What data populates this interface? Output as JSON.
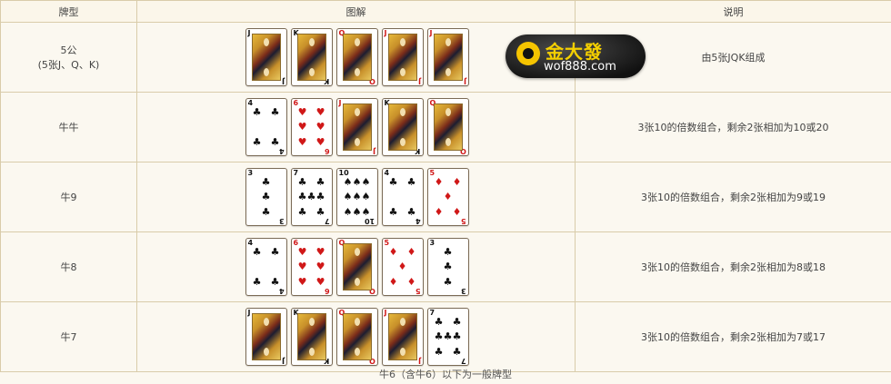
{
  "table": {
    "headers": [
      "牌型",
      "图解",
      "说明"
    ],
    "rows": [
      {
        "type": "5公",
        "type_sub": "(5张J、Q、K)",
        "note": "由5张JQK组成",
        "cards": [
          {
            "rank": "J",
            "suit": "♣",
            "color": "black",
            "face": true
          },
          {
            "rank": "K",
            "suit": "♣",
            "color": "black",
            "face": true
          },
          {
            "rank": "Q",
            "suit": "♥",
            "color": "red",
            "face": true
          },
          {
            "rank": "J",
            "suit": "♥",
            "color": "red",
            "face": true
          },
          {
            "rank": "J",
            "suit": "♦",
            "color": "red",
            "face": true
          }
        ]
      },
      {
        "type": "牛牛",
        "note": "3张10的倍数组合，剩余2张相加为10或20",
        "cards": [
          {
            "rank": "4",
            "suit": "♣",
            "color": "black",
            "face": false,
            "pips": 4
          },
          {
            "rank": "6",
            "suit": "♥",
            "color": "red",
            "face": false,
            "pips": 6
          },
          {
            "rank": "J",
            "suit": "♦",
            "color": "red",
            "face": true
          },
          {
            "rank": "K",
            "suit": "♣",
            "color": "black",
            "face": true
          },
          {
            "rank": "Q",
            "suit": "♥",
            "color": "red",
            "face": true
          }
        ]
      },
      {
        "type": "牛9",
        "note": "3张10的倍数组合，剩余2张相加为9或19",
        "cards": [
          {
            "rank": "3",
            "suit": "♣",
            "color": "black",
            "face": false,
            "pips": 3
          },
          {
            "rank": "7",
            "suit": "♣",
            "color": "black",
            "face": false,
            "pips": 7
          },
          {
            "rank": "10",
            "suit": "♠",
            "color": "black",
            "face": false,
            "pips": 10
          },
          {
            "rank": "4",
            "suit": "♣",
            "color": "black",
            "face": false,
            "pips": 4
          },
          {
            "rank": "5",
            "suit": "♦",
            "color": "red",
            "face": false,
            "pips": 5
          }
        ]
      },
      {
        "type": "牛8",
        "note": "3张10的倍数组合，剩余2张相加为8或18",
        "cards": [
          {
            "rank": "4",
            "suit": "♣",
            "color": "black",
            "face": false,
            "pips": 4
          },
          {
            "rank": "6",
            "suit": "♥",
            "color": "red",
            "face": false,
            "pips": 6
          },
          {
            "rank": "Q",
            "suit": "♥",
            "color": "red",
            "face": true
          },
          {
            "rank": "5",
            "suit": "♦",
            "color": "red",
            "face": false,
            "pips": 5
          },
          {
            "rank": "3",
            "suit": "♣",
            "color": "black",
            "face": false,
            "pips": 3
          }
        ]
      },
      {
        "type": "牛7",
        "note": "3张10的倍数组合，剩余2张相加为7或17",
        "cards": [
          {
            "rank": "J",
            "suit": "♣",
            "color": "black",
            "face": true
          },
          {
            "rank": "K",
            "suit": "♣",
            "color": "black",
            "face": true
          },
          {
            "rank": "Q",
            "suit": "♥",
            "color": "red",
            "face": true
          },
          {
            "rank": "J",
            "suit": "♥",
            "color": "red",
            "face": true
          },
          {
            "rank": "7",
            "suit": "♣",
            "color": "black",
            "face": false,
            "pips": 7
          }
        ]
      }
    ]
  },
  "footer": "牛6（含牛6）以下为一般牌型",
  "logo": {
    "name": "金大發",
    "url": "wof888.com"
  },
  "colors": {
    "border": "#d9ccaa",
    "background": "#fbf8f0",
    "red": "#d01818",
    "black": "#111111",
    "logo_yellow": "#f5c400"
  }
}
